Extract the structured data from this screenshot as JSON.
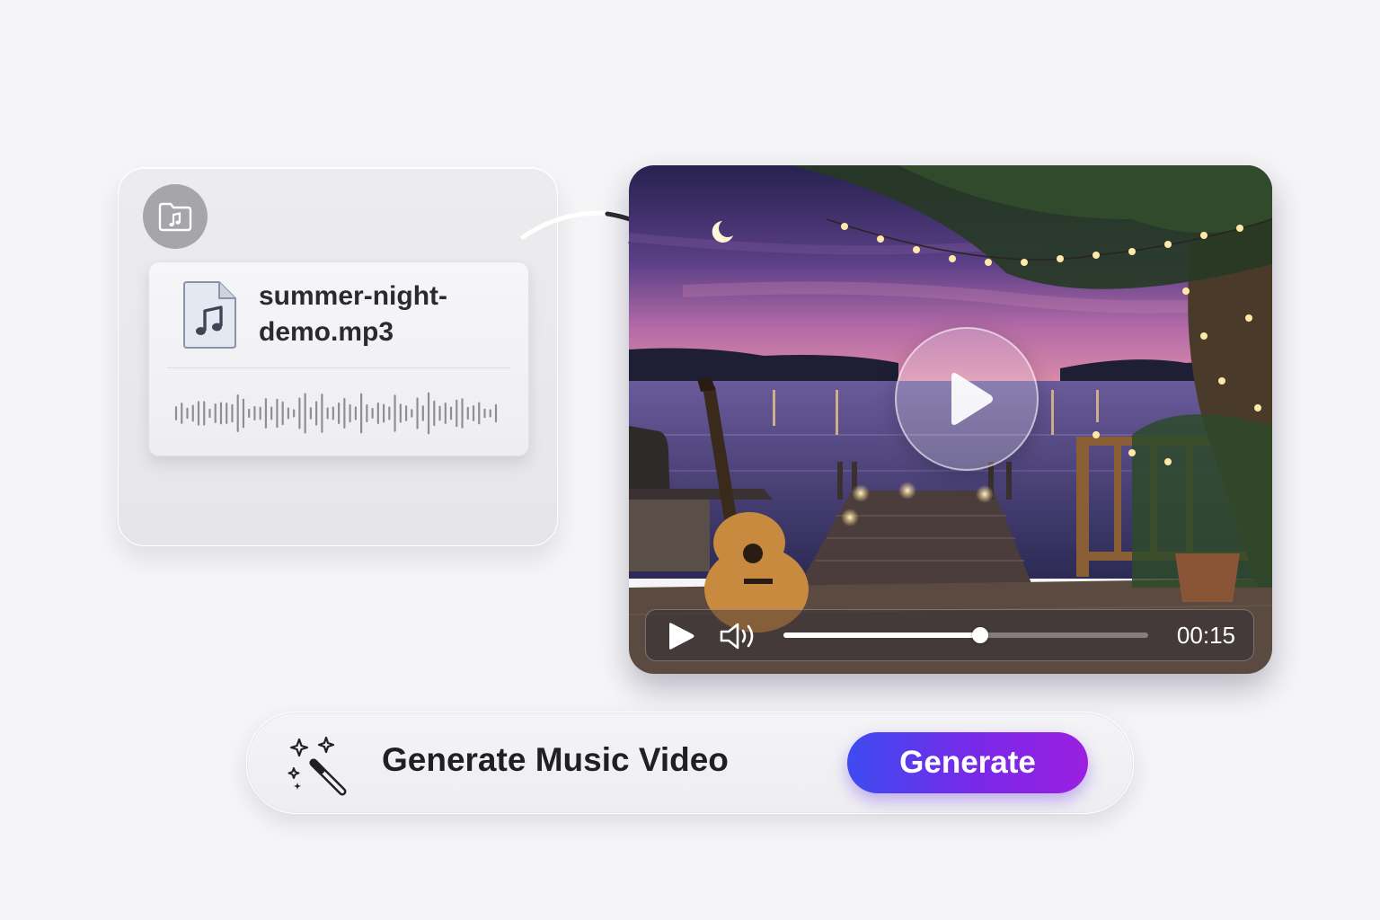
{
  "upload": {
    "folder_icon": "music-folder-icon",
    "file_icon": "music-file-icon",
    "file_name": "summer-night-demo.mp3"
  },
  "video": {
    "play_icon": "play-icon",
    "volume_icon": "volume-icon",
    "current_time": "00:15",
    "progress": 0.54
  },
  "generator": {
    "icon": "magic-wand-icon",
    "title": "Generate Music Video",
    "button_label": "Generate"
  },
  "colors": {
    "accent_start": "#3d4bf0",
    "accent_end": "#9b1fe0"
  }
}
